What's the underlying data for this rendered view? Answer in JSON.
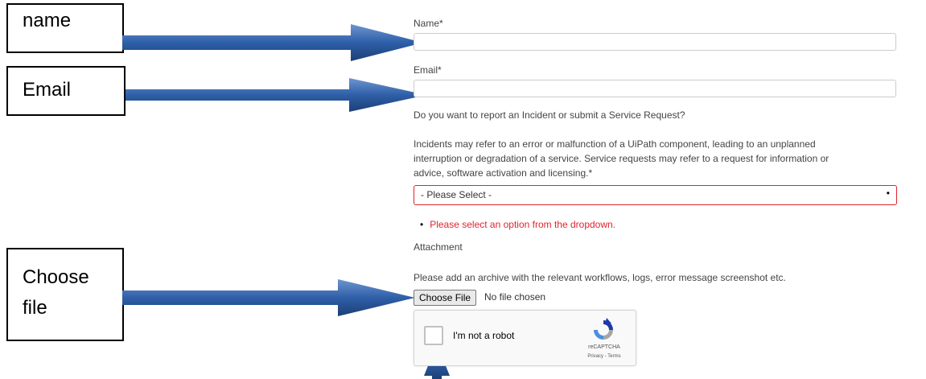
{
  "annotations": {
    "name_callout": "name",
    "email_callout": "Email",
    "choose_file_callout_line1": "Choose",
    "choose_file_callout_line2": "file",
    "arrow_color": "#2e5fa8"
  },
  "form": {
    "name_label": "Name*",
    "email_label": "Email*",
    "question": "Do you want to report an Incident or submit a Service Request?",
    "description_line1": "Incidents may refer to an error or malfunction of a UiPath component, leading to an unplanned",
    "description_line2": "interruption or degradation of a service. Service requests may refer to a request for information or",
    "description_line3": "advice, software activation and licensing.*",
    "select_value": "- Please Select -",
    "error_message": "Please select an option from the dropdown.",
    "attachment_label": "Attachment",
    "attachment_hint": "Please add an archive with the relevant workflows, logs, error message screenshot etc.",
    "choose_file_button": "Choose File",
    "file_status": "No file chosen",
    "error_color": "#e0242c"
  },
  "recaptcha": {
    "label": "I'm not a robot",
    "brand": "reCAPTCHA",
    "terms": "Privacy - Terms"
  }
}
